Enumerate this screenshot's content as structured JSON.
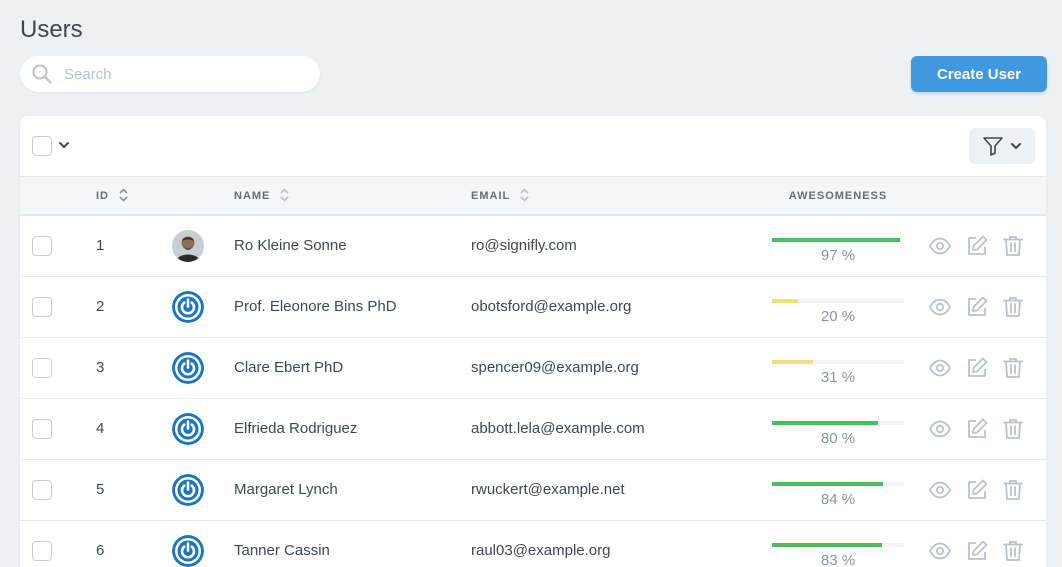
{
  "page": {
    "title": "Users"
  },
  "search": {
    "placeholder": "Search",
    "value": ""
  },
  "actions": {
    "create_label": "Create User"
  },
  "colors": {
    "accent": "#4099de",
    "bar_high": "#4cbe5d",
    "bar_low": "#ede27c",
    "icon": "#b8c2cc"
  },
  "table": {
    "columns": {
      "id": "ID",
      "name": "NAME",
      "email": "EMAIL",
      "awesomeness": "AWESOMENESS"
    },
    "rows": [
      {
        "id": "1",
        "name": "Ro Kleine Sonne",
        "email": "ro@signifly.com",
        "awesomeness": 97,
        "awesomeness_label": "97 %",
        "avatar": "photo"
      },
      {
        "id": "2",
        "name": "Prof. Eleonore Bins PhD",
        "email": "obotsford@example.org",
        "awesomeness": 20,
        "awesomeness_label": "20 %",
        "avatar": "power-icon"
      },
      {
        "id": "3",
        "name": "Clare Ebert PhD",
        "email": "spencer09@example.org",
        "awesomeness": 31,
        "awesomeness_label": "31 %",
        "avatar": "power-icon"
      },
      {
        "id": "4",
        "name": "Elfrieda Rodriguez",
        "email": "abbott.lela@example.com",
        "awesomeness": 80,
        "awesomeness_label": "80 %",
        "avatar": "power-icon"
      },
      {
        "id": "5",
        "name": "Margaret Lynch",
        "email": "rwuckert@example.net",
        "awesomeness": 84,
        "awesomeness_label": "84 %",
        "avatar": "power-icon"
      },
      {
        "id": "6",
        "name": "Tanner Cassin",
        "email": "raul03@example.org",
        "awesomeness": 83,
        "awesomeness_label": "83 %",
        "avatar": "power-icon"
      }
    ]
  }
}
